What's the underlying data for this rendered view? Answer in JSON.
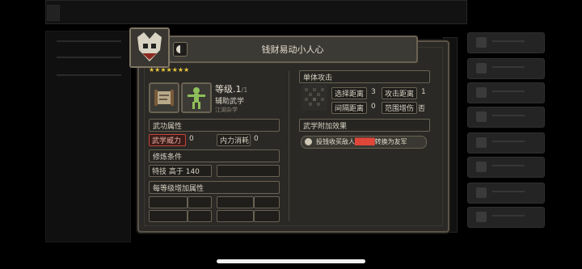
{
  "dialog": {
    "title": "钱财易动小人心",
    "stars": "★★★★★★★",
    "level_label": "等级.1",
    "level_max": "/1",
    "category": "辅助武学",
    "origin": "江湖杂学"
  },
  "sections": {
    "attributes": "武功属性",
    "requirements": "修炼条件",
    "bonus": "每等级增加属性",
    "single_attack": "单体攻击",
    "effect": "武学附加效果"
  },
  "attributes": [
    {
      "label": "武学威力",
      "value": "0"
    },
    {
      "label": "内力消耗",
      "value": "0"
    }
  ],
  "requirement": "特技 高于 140",
  "attack_stats": [
    {
      "label": "选择距离",
      "value": "3"
    },
    {
      "label": "攻击距离",
      "value": "1"
    },
    {
      "label": "间隔距离",
      "value": "0"
    },
    {
      "label": "范围增伤",
      "value": "否"
    }
  ],
  "effect": {
    "prefix": "投钱收买敌人",
    "highlight": "████",
    "suffix": "转换为友军"
  },
  "colors": {
    "accent_red": "#e0463a",
    "star": "#e9c73a"
  }
}
